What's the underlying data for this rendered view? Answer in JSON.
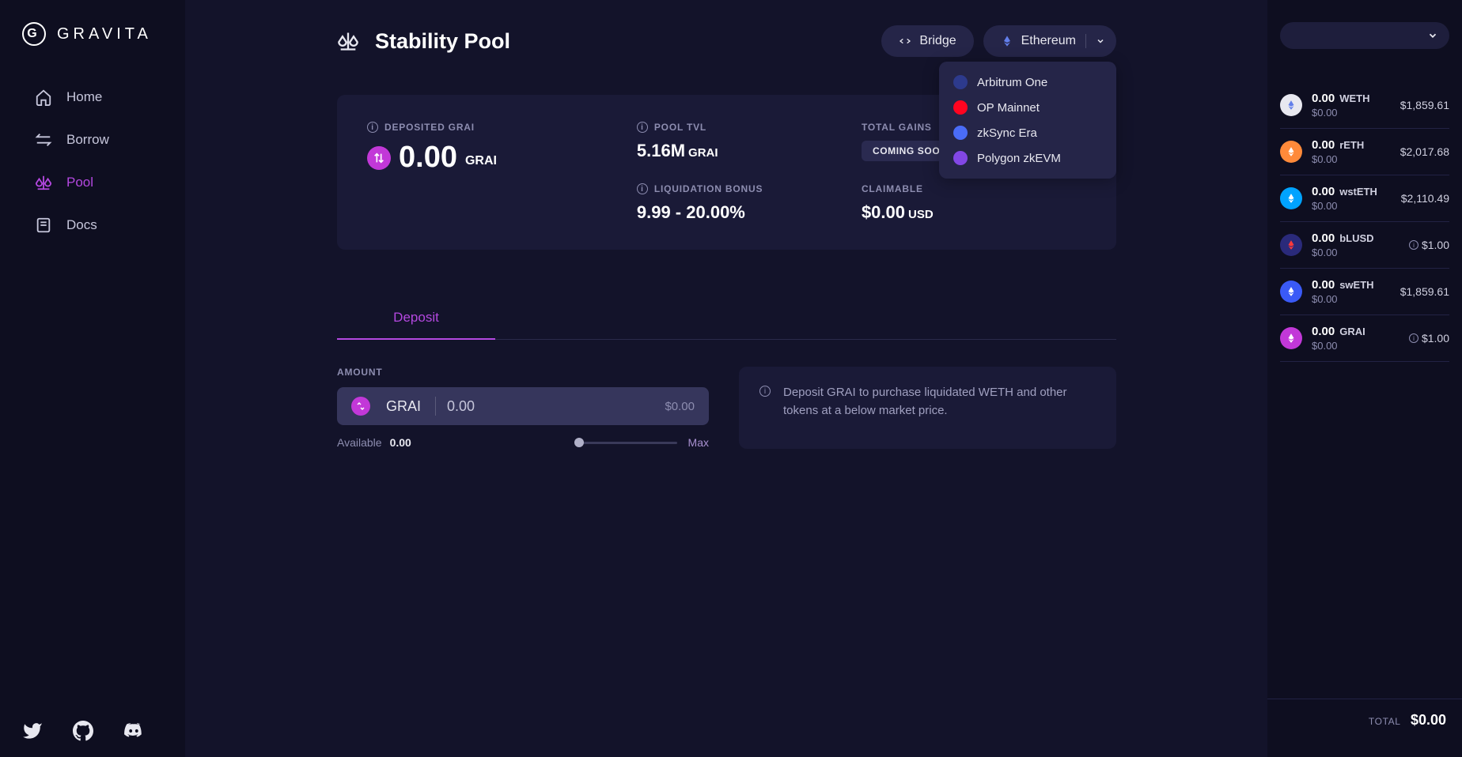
{
  "brand": "GRAVITA",
  "nav": {
    "home": "Home",
    "borrow": "Borrow",
    "pool": "Pool",
    "docs": "Docs"
  },
  "page": {
    "title": "Stability Pool"
  },
  "actions": {
    "bridge": "Bridge",
    "network": "Ethereum"
  },
  "networks": [
    {
      "name": "Arbitrum One",
      "color": "#2d3a8c"
    },
    {
      "name": "OP Mainnet",
      "color": "#ff0420"
    },
    {
      "name": "zkSync Era",
      "color": "#4a6cf7"
    },
    {
      "name": "Polygon zkEVM",
      "color": "#8247e5"
    }
  ],
  "stats": {
    "deposited_label": "DEPOSITED GRAI",
    "deposited_value": "0.00",
    "deposited_unit": "GRAI",
    "tvl_label": "POOL TVL",
    "tvl_value": "5.16M",
    "tvl_unit": "GRAI",
    "total_gains_label": "TOTAL GAINS",
    "coming_soon": "COMING SOON",
    "liq_label": "LIQUIDATION BONUS",
    "liq_value": "9.99 - 20.00%",
    "claim_label": "CLAIMABLE",
    "claim_value": "$0.00",
    "claim_unit": "USD"
  },
  "tabs": {
    "deposit": "Deposit"
  },
  "form": {
    "amount_label": "AMOUNT",
    "token": "GRAI",
    "value": "0.00",
    "usd": "$0.00",
    "available_label": "Available",
    "available_value": "0.00",
    "max": "Max"
  },
  "notice": "Deposit GRAI to purchase liquidated WETH and other tokens at a below market price.",
  "balances": [
    {
      "amt": "0.00",
      "sym": "WETH",
      "sub": "$0.00",
      "price": "$1,859.61",
      "coin_bg": "#e8e8f0",
      "coin_fg": "#627eea",
      "info": false
    },
    {
      "amt": "0.00",
      "sym": "rETH",
      "sub": "$0.00",
      "price": "$2,017.68",
      "coin_bg": "#ff8a3a",
      "coin_fg": "#fff",
      "info": false
    },
    {
      "amt": "0.00",
      "sym": "wstETH",
      "sub": "$0.00",
      "price": "$2,110.49",
      "coin_bg": "#00a3ff",
      "coin_fg": "#fff",
      "info": false
    },
    {
      "amt": "0.00",
      "sym": "bLUSD",
      "sub": "$0.00",
      "price": "$1.00",
      "coin_bg": "#2a2a7a",
      "coin_fg": "#ff3a3a",
      "info": true
    },
    {
      "amt": "0.00",
      "sym": "swETH",
      "sub": "$0.00",
      "price": "$1,859.61",
      "coin_bg": "#3a5af7",
      "coin_fg": "#fff",
      "info": false
    },
    {
      "amt": "0.00",
      "sym": "GRAI",
      "sub": "$0.00",
      "price": "$1.00",
      "coin_bg": "#c238d8",
      "coin_fg": "#fff",
      "info": true
    }
  ],
  "total": {
    "label": "TOTAL",
    "value": "$0.00"
  }
}
